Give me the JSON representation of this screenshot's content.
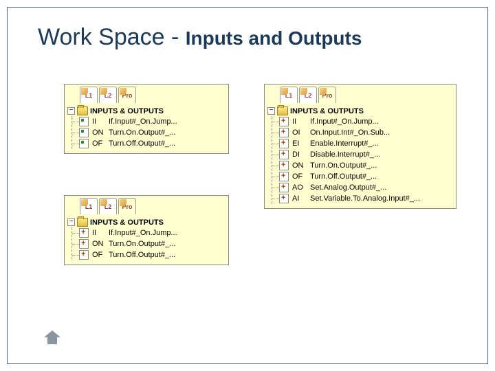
{
  "title_main": "Work Space - ",
  "title_sub": "Inputs and Outputs",
  "tabs": [
    "L1",
    "L2",
    "Pro"
  ],
  "panel_a": {
    "root": "INPUTS & OUTPUTS",
    "items": [
      {
        "code": "II",
        "label": "If.Input#_On.Jump..."
      },
      {
        "code": "ON",
        "label": "Turn.On.Output#_..."
      },
      {
        "code": "OF",
        "label": "Turn.Off.Output#_..."
      }
    ]
  },
  "panel_b": {
    "root": "INPUTS & OUTPUTS",
    "items": [
      {
        "code": "II",
        "label": "If.Input#_On.Jump..."
      },
      {
        "code": "ON",
        "label": "Turn.On.Output#_..."
      },
      {
        "code": "OF",
        "label": "Turn.Off.Output#_..."
      }
    ]
  },
  "panel_c": {
    "root": "INPUTS & OUTPUTS",
    "items": [
      {
        "code": "II",
        "label": "If.Input#_On.Jump..."
      },
      {
        "code": "OI",
        "label": "On.Input.Int#_On.Sub..."
      },
      {
        "code": "EI",
        "label": "Enable.Interrupt#_..."
      },
      {
        "code": "DI",
        "label": "Disable.Interrupt#_..."
      },
      {
        "code": "ON",
        "label": "Turn.On.Output#_..."
      },
      {
        "code": "OF",
        "label": "Turn.Off.Output#_..."
      },
      {
        "code": "AO",
        "label": "Set.Analog.Output#_..."
      },
      {
        "code": "AI",
        "label": "Set.Variable.To.Analog.Input#_..."
      }
    ]
  },
  "expand_sym": "−"
}
